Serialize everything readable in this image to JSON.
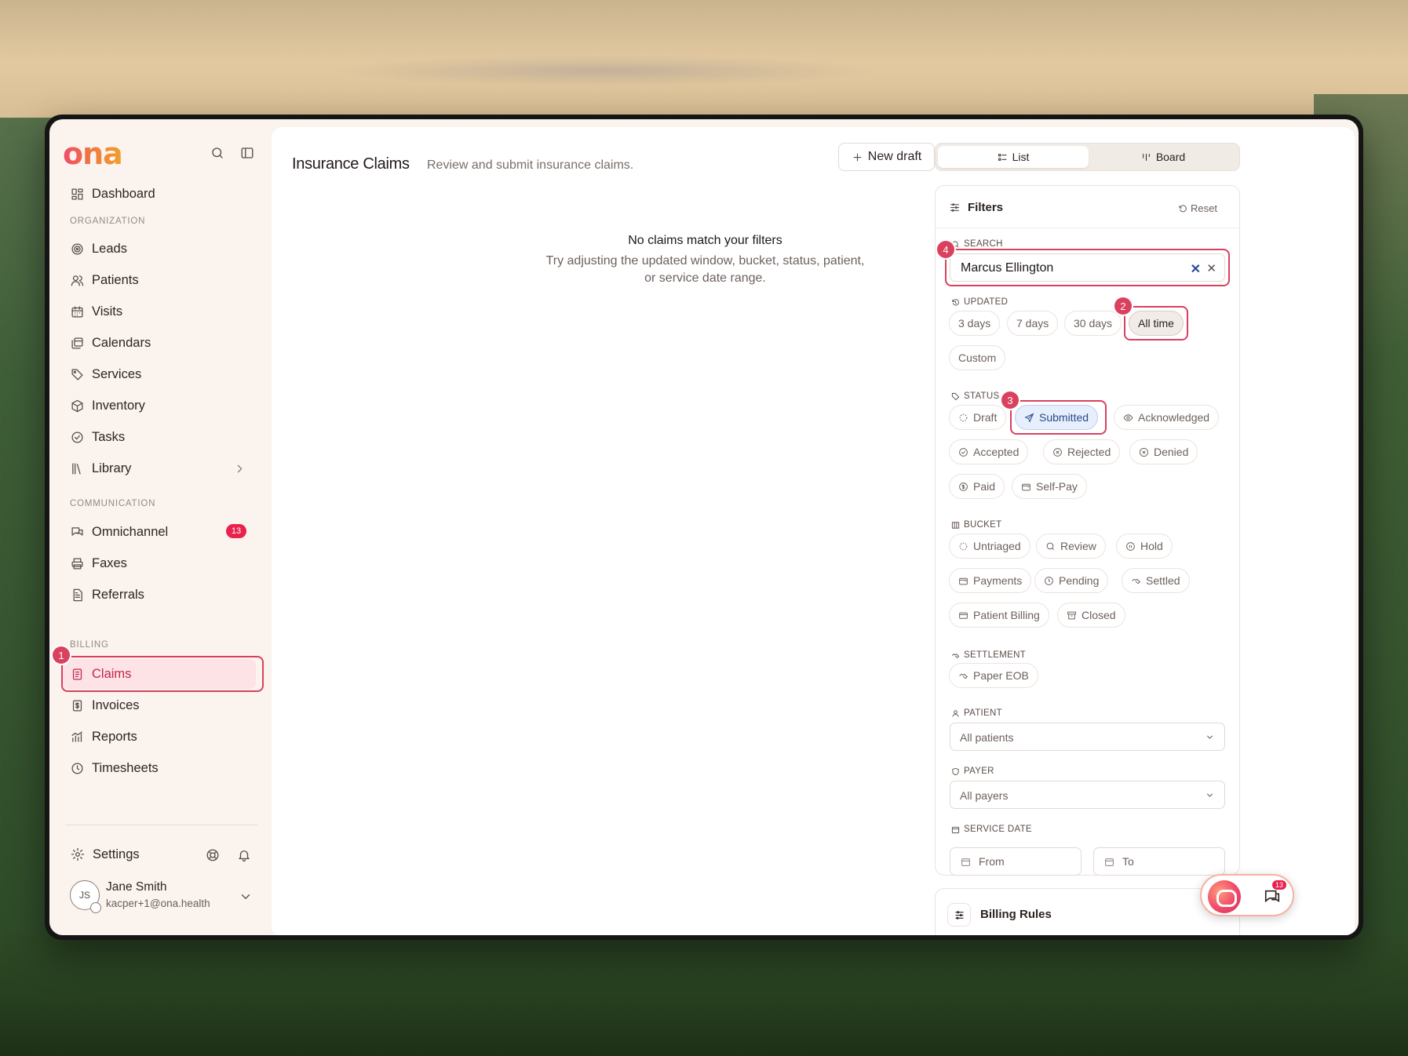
{
  "brand": {
    "logo": "ona"
  },
  "sidebar": {
    "dashboard": "Dashboard",
    "organization_label": "ORGANIZATION",
    "organization_items": [
      {
        "label": "Leads",
        "icon": "target-icon"
      },
      {
        "label": "Patients",
        "icon": "users-icon"
      },
      {
        "label": "Visits",
        "icon": "calendar-grid-icon"
      },
      {
        "label": "Calendars",
        "icon": "calendars-icon"
      },
      {
        "label": "Services",
        "icon": "tag-icon"
      },
      {
        "label": "Inventory",
        "icon": "box-icon"
      },
      {
        "label": "Tasks",
        "icon": "check-circle-icon"
      },
      {
        "label": "Library",
        "icon": "library-icon"
      }
    ],
    "communication_label": "COMMUNICATION",
    "communication_items": [
      {
        "label": "Omnichannel",
        "icon": "chat-icon",
        "badge": "13"
      },
      {
        "label": "Faxes",
        "icon": "printer-icon"
      },
      {
        "label": "Referrals",
        "icon": "document-icon"
      }
    ],
    "billing_label": "BILLING",
    "billing_items": [
      {
        "label": "Claims",
        "icon": "claim-doc-icon",
        "active": true
      },
      {
        "label": "Invoices",
        "icon": "invoice-icon"
      },
      {
        "label": "Reports",
        "icon": "chart-icon"
      },
      {
        "label": "Timesheets",
        "icon": "clock-icon"
      }
    ],
    "settings": "Settings",
    "user": {
      "initials": "JS",
      "name": "Jane Smith",
      "email": "kacper+1@ona.health"
    }
  },
  "main": {
    "title": "Insurance Claims",
    "subtitle": "Review and submit insurance claims.",
    "new_draft": "New draft",
    "views": [
      "List",
      "Board"
    ],
    "empty_title": "No claims match your filters",
    "empty_desc_1": "Try adjusting the updated window, bucket, status, patient,",
    "empty_desc_2": "or service date range."
  },
  "filters": {
    "title": "Filters",
    "reset": "Reset",
    "search_label": "SEARCH",
    "search_value": "Marcus Ellington",
    "updated_label": "UPDATED",
    "updated_options": [
      "3 days",
      "7 days",
      "30 days",
      "All time",
      "Custom"
    ],
    "updated_selected": "All time",
    "status_label": "STATUS",
    "status_options": [
      "Draft",
      "Submitted",
      "Acknowledged",
      "Accepted",
      "Rejected",
      "Denied",
      "Paid",
      "Self-Pay"
    ],
    "status_selected": "Submitted",
    "bucket_label": "BUCKET",
    "bucket_options": [
      "Untriaged",
      "Review",
      "Hold",
      "Payments",
      "Pending",
      "Settled",
      "Patient Billing",
      "Closed"
    ],
    "settlement_label": "SETTLEMENT",
    "settlement_options": [
      "Paper EOB"
    ],
    "patient_label": "PATIENT",
    "patient_value": "All patients",
    "payer_label": "PAYER",
    "payer_value": "All payers",
    "service_date_label": "SERVICE DATE",
    "date_from": "From",
    "date_to": "To"
  },
  "billing_rules": {
    "title": "Billing Rules"
  },
  "steps": [
    "1",
    "2",
    "3",
    "4"
  ],
  "fab": {
    "badge": "13"
  },
  "colors": {
    "accent": "#d9415f",
    "active_bg": "#fde2e6",
    "selected_blue": "#e7effc"
  }
}
